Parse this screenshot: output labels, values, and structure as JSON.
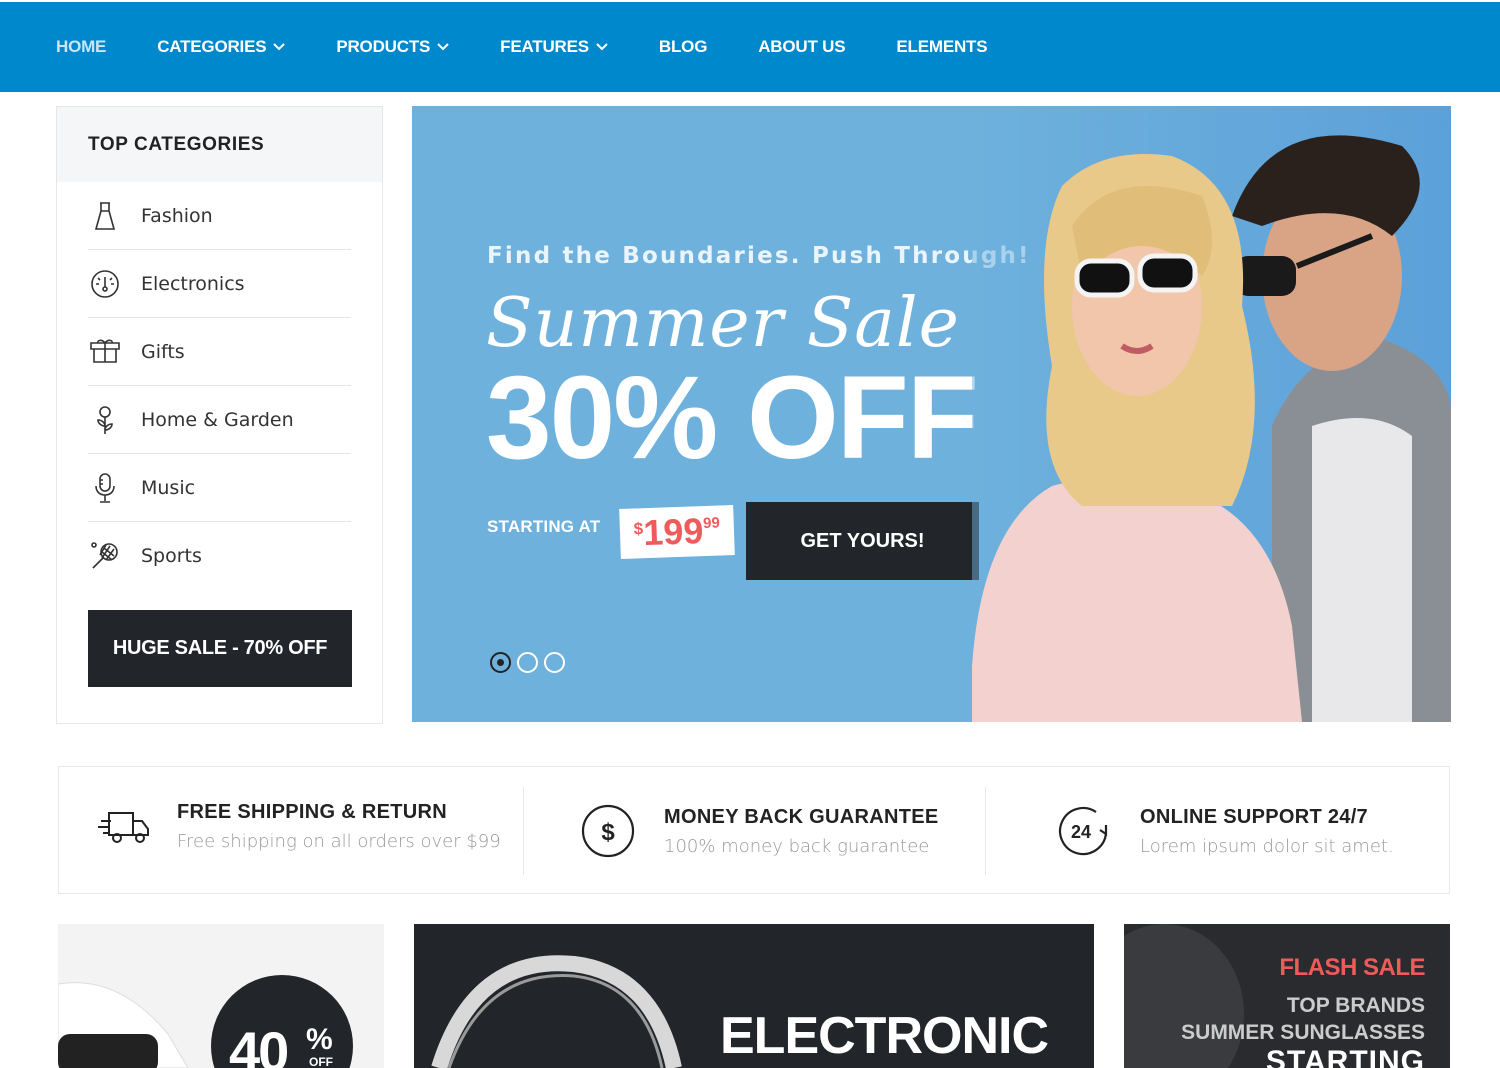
{
  "nav": {
    "items": [
      {
        "label": "HOME",
        "dropdown": false,
        "active": true
      },
      {
        "label": "CATEGORIES",
        "dropdown": true
      },
      {
        "label": "PRODUCTS",
        "dropdown": true
      },
      {
        "label": "FEATURES",
        "dropdown": true
      },
      {
        "label": "BLOG",
        "dropdown": false
      },
      {
        "label": "ABOUT US",
        "dropdown": false
      },
      {
        "label": "ELEMENTS",
        "dropdown": false
      }
    ]
  },
  "sidebar": {
    "title": "TOP CATEGORIES",
    "items": [
      {
        "label": "Fashion",
        "icon": "dress-icon"
      },
      {
        "label": "Electronics",
        "icon": "gauge-icon"
      },
      {
        "label": "Gifts",
        "icon": "gift-icon"
      },
      {
        "label": "Home & Garden",
        "icon": "plant-icon"
      },
      {
        "label": "Music",
        "icon": "microphone-icon"
      },
      {
        "label": "Sports",
        "icon": "racket-icon"
      }
    ],
    "sale_button": "HUGE SALE - 70% OFF"
  },
  "hero": {
    "subtitle": "Find the Boundaries. Push Through!",
    "script_title": "Summer Sale",
    "headline": "30% OFF",
    "starting_label": "STARTING AT",
    "price_currency": "$",
    "price_int": "199",
    "price_cents": "99",
    "cta": "GET YOURS!",
    "slides": 3,
    "active_slide": 1
  },
  "features": [
    {
      "title": "FREE SHIPPING & RETURN",
      "desc": "Free shipping on all orders over $99",
      "icon": "truck-icon"
    },
    {
      "title": "MONEY BACK GUARANTEE",
      "desc": "100% money back guarantee",
      "icon": "dollar-icon"
    },
    {
      "title": "ONLINE SUPPORT 24/7",
      "desc": "Lorem ipsum dolor sit amet.",
      "icon": "support-24-icon"
    }
  ],
  "banners": {
    "watch": {
      "percent": "40",
      "percent_sign": "%",
      "off": "OFF"
    },
    "electronic": {
      "title": "ELECTRONIC"
    },
    "flash": {
      "title": "FLASH SALE",
      "line1": "TOP BRANDS",
      "line2": "SUMMER SUNGLASSES",
      "line3": "STARTING"
    }
  },
  "colors": {
    "nav": "#0088cc",
    "hero_bg": "#6eb1dd",
    "dark": "#222529",
    "accent": "#ef5b5b"
  }
}
